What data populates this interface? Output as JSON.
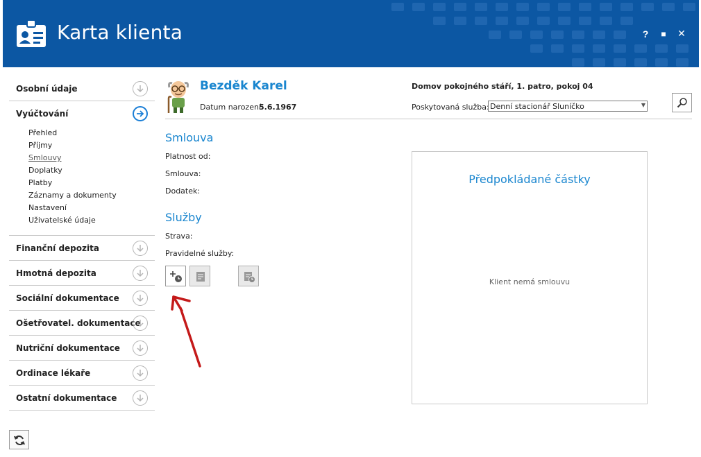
{
  "window": {
    "title": "Karta klienta",
    "buttons": {
      "help": "?",
      "maximize": "■",
      "close": "✕"
    },
    "accent_color": "#0c57a3"
  },
  "sidebar": {
    "sections": [
      {
        "label": "Osobní údaje",
        "icon": "arrow-down-circle-icon"
      },
      {
        "label": "Vyúčtování",
        "icon": "arrow-right-circle-icon",
        "active": true
      },
      {
        "label": "Finanční depozita",
        "icon": "arrow-down-circle-icon"
      },
      {
        "label": "Hmotná depozita",
        "icon": "arrow-down-circle-icon"
      },
      {
        "label": "Sociální dokumentace",
        "icon": "arrow-down-circle-icon"
      },
      {
        "label": "Ošetřovatel. dokumentace",
        "icon": "arrow-down-circle-icon"
      },
      {
        "label": "Nutriční dokumentace",
        "icon": "arrow-down-circle-icon"
      },
      {
        "label": "Ordinace lékaře",
        "icon": "arrow-down-circle-icon"
      },
      {
        "label": "Ostatní dokumentace",
        "icon": "arrow-down-circle-icon"
      }
    ],
    "subitems": [
      "Přehled",
      "Příjmy",
      "Smlouvy",
      "Doplatky",
      "Platby",
      "Záznamy a dokumenty",
      "Nastavení",
      "Uživatelské údaje"
    ],
    "current_subitem": "Smlouvy"
  },
  "client": {
    "name": "Bezděk Karel",
    "dob_label": "Datum narození:",
    "dob_value": "5.6.1967",
    "facility": "Domov pokojného stáří, 1. patro, pokoj 04",
    "service_label": "Poskytovaná služba:",
    "service_value": "Denní stacionář Sluníčko"
  },
  "contract": {
    "title": "Smlouva",
    "fields": [
      "Platnost od:",
      "Smlouva:",
      "Dodatek:"
    ]
  },
  "services": {
    "title": "Služby",
    "fields": [
      "Strava:",
      "Pravidelné služby:"
    ]
  },
  "panel": {
    "title": "Předpokládané částky",
    "empty_text": "Klient nemá smlouvu"
  }
}
